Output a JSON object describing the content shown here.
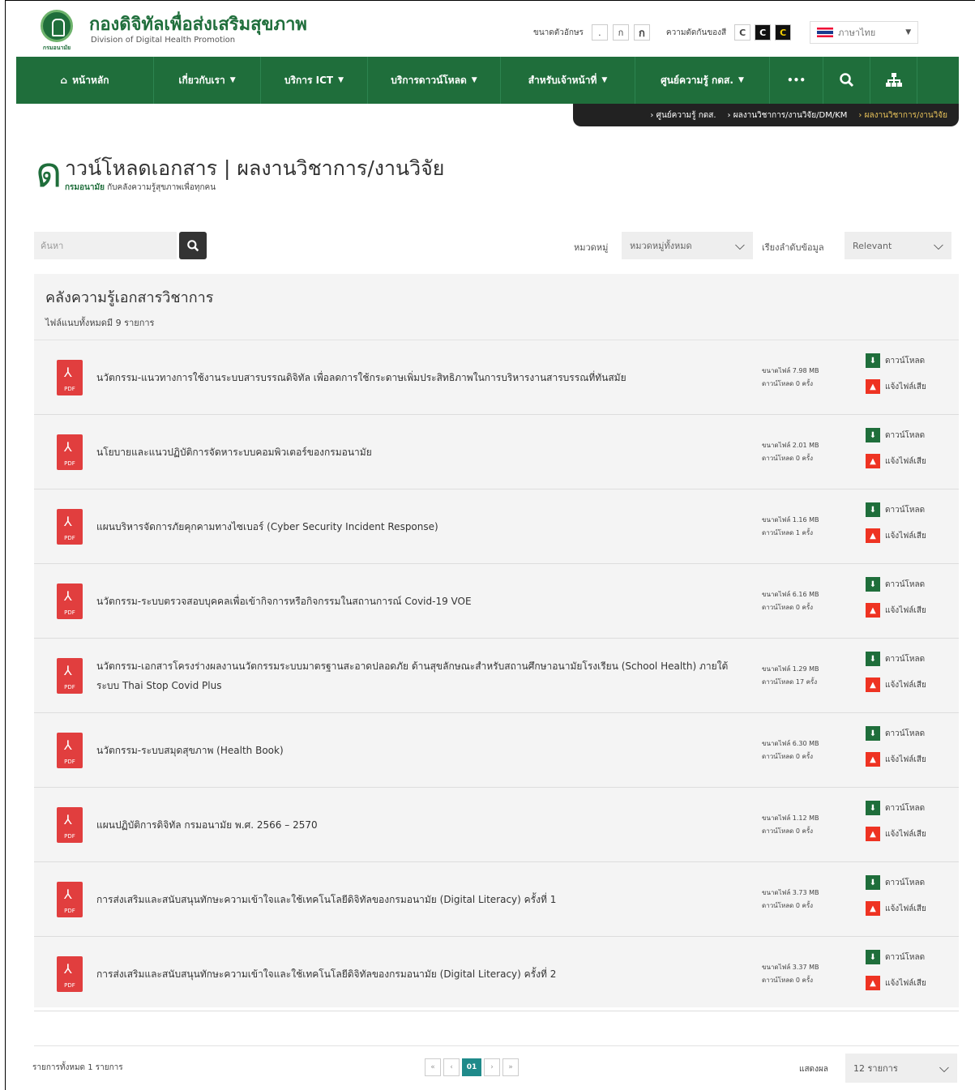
{
  "header": {
    "logo_caption": "กรมอนามัย",
    "title": "กองดิจิทัลเพื่อส่งเสริมสุขภาพ",
    "subtitle": "Division of Digital Health Promotion",
    "font_size_label": "ขนาดตัวอักษร",
    "font_sizes": [
      ".",
      "ก",
      "ก"
    ],
    "contrast_label": "ความตัดกันของสี",
    "contrast_options": [
      "C",
      "C",
      "C"
    ],
    "language": "ภาษาไทย"
  },
  "nav": {
    "items": [
      {
        "label": "หน้าหลัก",
        "icon": "home-icon"
      },
      {
        "label": "เกี่ยวกับเรา"
      },
      {
        "label": "บริการ ICT"
      },
      {
        "label": "บริการดาวน์โหลด"
      },
      {
        "label": "สำหรับเจ้าหน้าที่"
      },
      {
        "label": "ศูนย์ความรู้ กดส."
      },
      {
        "label": "•••"
      }
    ],
    "search_icon": "search-icon",
    "sitemap_icon": "sitemap-icon"
  },
  "breadcrumb": {
    "items": [
      "ศูนย์ความรู้ กดส.",
      "ผลงานวิชาการ/งานวิจัย/DM/KM",
      "ผลงานวิชาการ/งานวิจัย"
    ]
  },
  "page": {
    "big_letter": "ด",
    "title": "าวน์โหลดเอกสาร | ผลงานวิชาการ/งานวิจัย",
    "sub_bold": "กรมอนามัย",
    "sub_rest": "กับคลังความรู้สุขภาพเพื่อทุกคน"
  },
  "filters": {
    "search_placeholder": "ค้นหา",
    "category_label": "หมวดหมู่",
    "category_value": "หมวดหมู่ทั้งหมด",
    "sort_label": "เรียงลำดับข้อมูล",
    "sort_value": "Relevant"
  },
  "panel": {
    "title": "คลังความรู้เอกสารวิชาการ",
    "count": "ไฟล์แนบทั้งหมดมี 9 รายการ"
  },
  "action_labels": {
    "download": "ดาวน์โหลด",
    "report": "แจ้งไฟล์เสีย",
    "pdf": "PDF"
  },
  "documents": [
    {
      "title": "นวัตกรรม-แนวทางการใช้งานระบบสารบรรณดิจิทัล เพื่อลดการใช้กระดาษเพิ่มประสิทธิภาพในการบริหารงานสารบรรณที่ทันสมัย",
      "size": "ขนาดไฟล์ 7.98 MB",
      "downloads": "ดาวน์โหลด 0 ครั้ง"
    },
    {
      "title": "นโยบายและแนวปฏิบัติการจัดหาระบบคอมพิวเตอร์ของกรมอนามัย",
      "size": "ขนาดไฟล์ 2.01 MB",
      "downloads": "ดาวน์โหลด 0 ครั้ง"
    },
    {
      "title": "แผนบริหารจัดการภัยคุกคามทางไซเบอร์ (Cyber Security Incident Response)",
      "size": "ขนาดไฟล์ 1.16 MB",
      "downloads": "ดาวน์โหลด 1 ครั้ง"
    },
    {
      "title": "นวัตกรรม-ระบบตรวจสอบบุคคลเพื่อเข้ากิจการหรือกิจกรรมในสถานการณ์ Covid-19 VOE",
      "size": "ขนาดไฟล์ 6.16 MB",
      "downloads": "ดาวน์โหลด 0 ครั้ง"
    },
    {
      "title": "นวัตกรรม-เอกสารโครงร่างผลงานนวัตกรรมระบบมาตรฐานสะอาดปลอดภัย ด้านสุขลักษณะสำหรับสถานศึกษาอนามัยโรงเรียน (School Health) ภายใต้ระบบ Thai Stop Covid Plus",
      "size": "ขนาดไฟล์ 1.29 MB",
      "downloads": "ดาวน์โหลด 17 ครั้ง"
    },
    {
      "title": "นวัตกรรม-ระบบสมุดสุขภาพ (Health Book)",
      "size": "ขนาดไฟล์ 6.30 MB",
      "downloads": "ดาวน์โหลด 0 ครั้ง"
    },
    {
      "title": "แผนปฏิบัติการดิจิทัล กรมอนามัย พ.ศ. 2566 – 2570",
      "size": "ขนาดไฟล์ 1.12 MB",
      "downloads": "ดาวน์โหลด 0 ครั้ง"
    },
    {
      "title": "การส่งเสริมและสนับสนุนทักษะความเข้าใจและใช้เทคโนโลยีดิจิทัลของกรมอนามัย (Digital Literacy) ครั้งที่ 1",
      "size": "ขนาดไฟล์ 3.73 MB",
      "downloads": "ดาวน์โหลด 0 ครั้ง"
    },
    {
      "title": "การส่งเสริมและสนับสนุนทักษะความเข้าใจและใช้เทคโนโลยีดิจิทัลของกรมอนามัย (Digital Literacy) ครั้งที่ 2",
      "size": "ขนาดไฟล์ 3.37 MB",
      "downloads": "ดาวน์โหลด 0 ครั้ง"
    }
  ],
  "footer": {
    "total": "รายการทั้งหมด 1 รายการ",
    "pager": [
      "«",
      "‹",
      "01",
      "›",
      "»"
    ],
    "show_label": "แสดงผล",
    "show_value": "12 รายการ"
  }
}
